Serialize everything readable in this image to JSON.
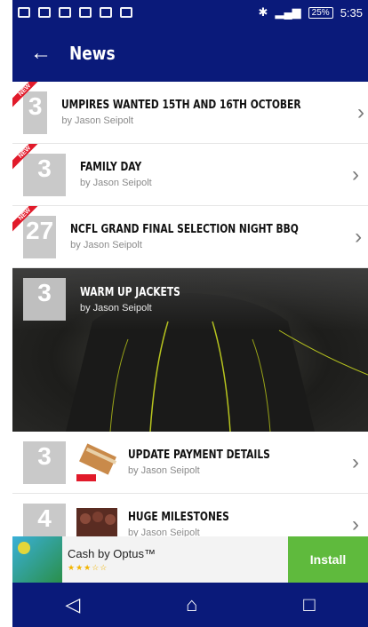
{
  "status": {
    "battery": "25%",
    "time": "5:35"
  },
  "header": {
    "title": "News"
  },
  "items": [
    {
      "day": "3",
      "badge": "NEW",
      "title": "UMPIRES WANTED 15TH AND 16TH OCTOBER",
      "author": "by Jason Seipolt"
    },
    {
      "day": "3",
      "badge": "NEW",
      "title": "FAMILY DAY",
      "author": "by Jason Seipolt"
    },
    {
      "day": "27",
      "badge": "NEW",
      "title": "NCFL GRAND FINAL SELECTION NIGHT BBQ",
      "author": "by Jason Seipolt"
    },
    {
      "day": "3",
      "title": "WARM UP JACKETS",
      "author": "by Jason Seipolt"
    },
    {
      "day": "3",
      "title": "UPDATE PAYMENT DETAILS",
      "author": "by Jason Seipolt"
    },
    {
      "day": "4",
      "title": "HUGE MILESTONES",
      "author": "by Jason Seipolt"
    }
  ],
  "ad": {
    "app_name": "Cash by Optus™",
    "stars": "★★★☆☆",
    "cta": "Install"
  },
  "icons": {
    "back": "back-arrow-icon",
    "chevron": "chevron-right-icon",
    "nav_back": "nav-back-icon",
    "nav_home": "nav-home-icon",
    "nav_recents": "nav-recents-icon"
  },
  "colors": {
    "primary": "#0a1a7a",
    "new_badge": "#e11a2a",
    "install": "#5fba3d"
  }
}
